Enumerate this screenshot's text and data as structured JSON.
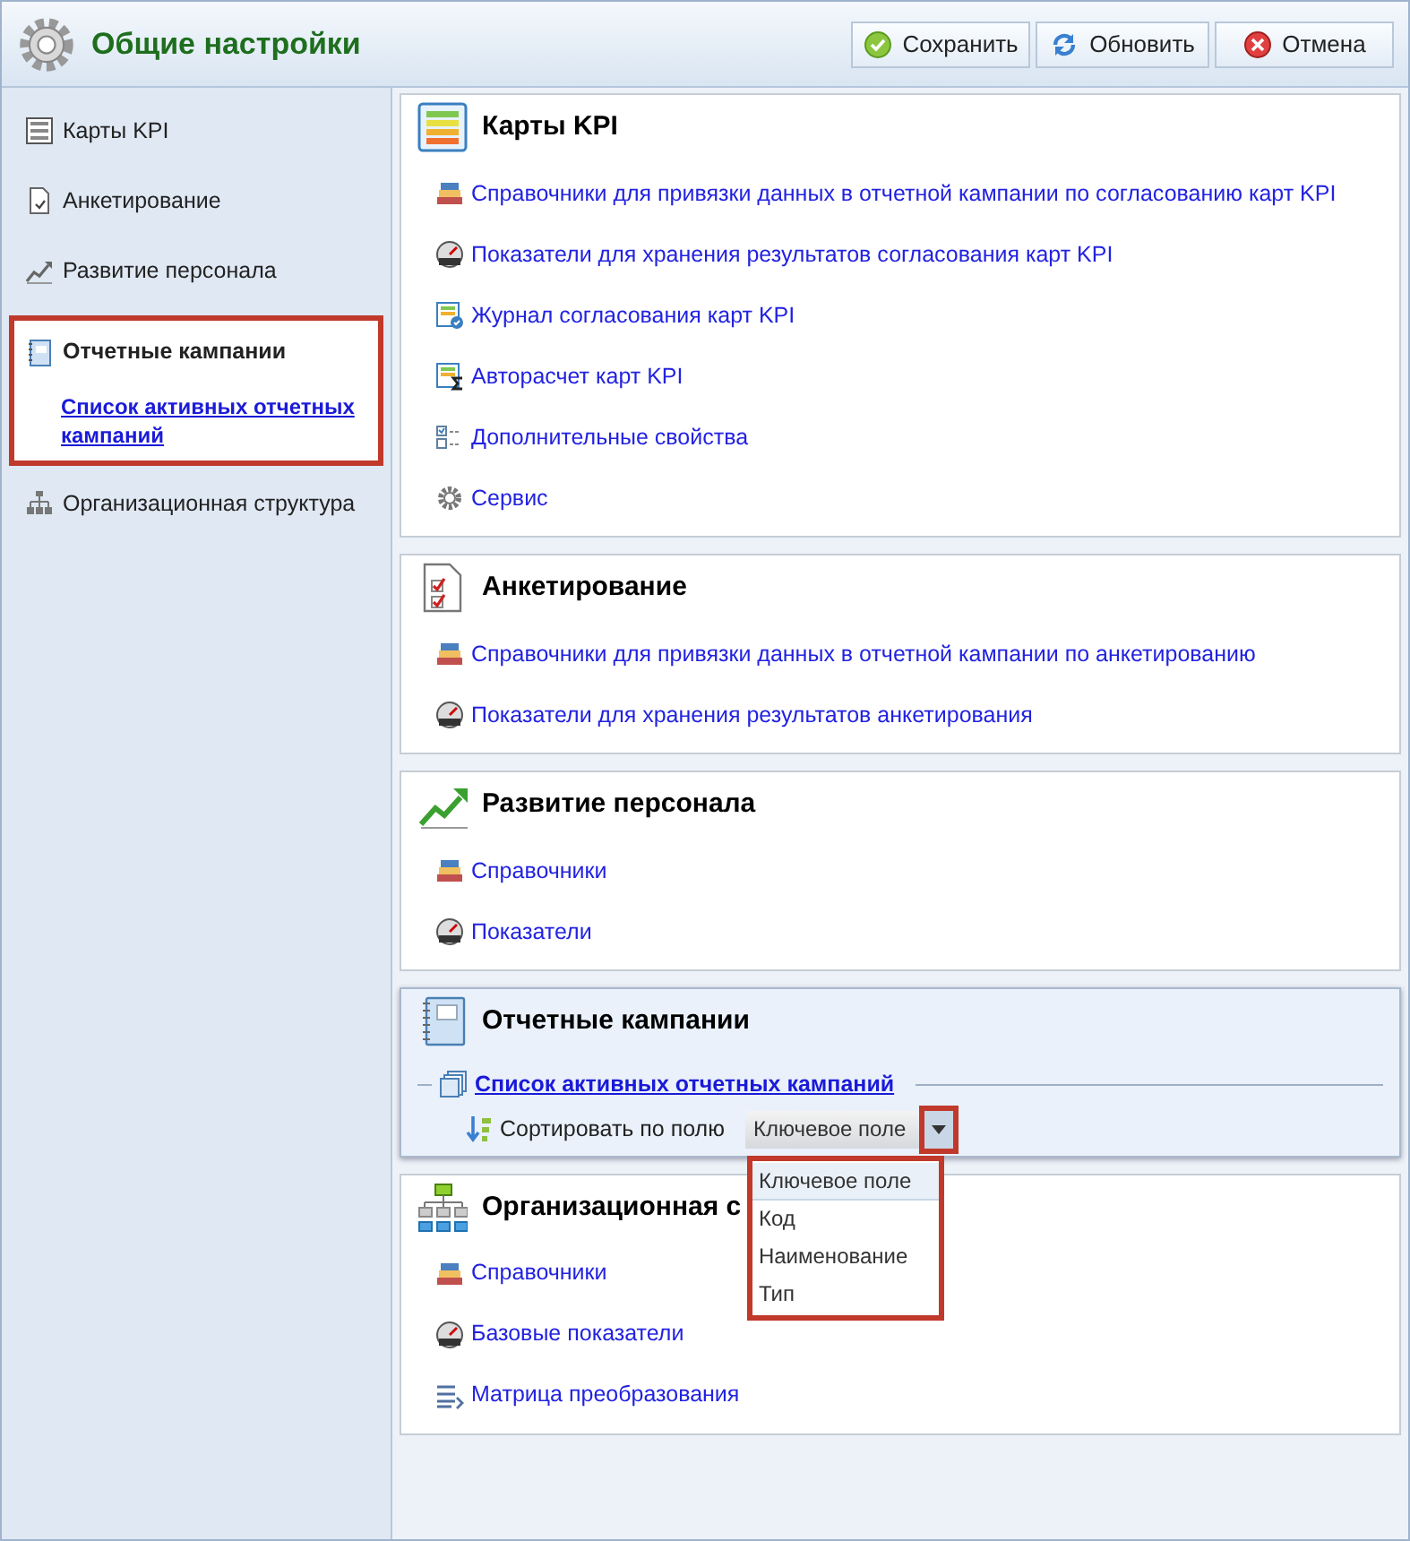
{
  "header": {
    "title": "Общие настройки",
    "buttons": [
      {
        "label": "Сохранить",
        "kind": "save"
      },
      {
        "label": "Обновить",
        "kind": "refresh"
      },
      {
        "label": "Отмена",
        "kind": "cancel"
      }
    ]
  },
  "sidebar": {
    "items": [
      {
        "label": "Карты KPI",
        "kind": "kpi",
        "selected": false
      },
      {
        "label": "Анкетирование",
        "kind": "survey",
        "selected": false
      },
      {
        "label": "Развитие персонала",
        "kind": "growth",
        "selected": false
      },
      {
        "label": "Отчетные кампании",
        "kind": "notebook",
        "selected": true,
        "children": [
          {
            "label": "Список активных отчетных кампаний"
          }
        ]
      },
      {
        "label": "Организационная структура",
        "kind": "org",
        "selected": false
      }
    ]
  },
  "sections": [
    {
      "title": "Карты KPI",
      "kind": "kpi",
      "selected": false,
      "links": [
        {
          "label": "Справочники для привязки данных в отчетной кампании по согласованию карт KPI",
          "kind": "books"
        },
        {
          "label": "Показатели для хранения результатов согласования карт KPI",
          "kind": "gauge"
        },
        {
          "label": "Журнал согласования карт KPI",
          "kind": "journal"
        },
        {
          "label": "Авторасчет карт KPI",
          "kind": "autocalc"
        },
        {
          "label": "Дополнительные свойства",
          "kind": "props"
        },
        {
          "label": "Сервис",
          "kind": "gear"
        }
      ]
    },
    {
      "title": "Анкетирование",
      "kind": "survey",
      "selected": false,
      "links": [
        {
          "label": "Справочники для привязки данных в отчетной кампании по анкетированию",
          "kind": "books"
        },
        {
          "label": "Показатели для хранения результатов анкетирования",
          "kind": "gauge"
        }
      ]
    },
    {
      "title": "Развитие персонала",
      "kind": "growth",
      "selected": false,
      "links": [
        {
          "label": "Справочники",
          "kind": "books"
        },
        {
          "label": "Показатели",
          "kind": "gauge"
        }
      ]
    },
    {
      "title": "Отчетные кампании",
      "kind": "notebook",
      "selected": true,
      "group": {
        "label": "Список активных отчетных кампаний",
        "sort": {
          "label": "Сортировать по полю",
          "value": "Ключевое поле",
          "highlighted": true,
          "expanded": true,
          "options": [
            {
              "label": "Ключевое поле",
              "selected": true
            },
            {
              "label": "Код",
              "selected": false
            },
            {
              "label": "Наименование",
              "selected": false
            },
            {
              "label": "Тип",
              "selected": false
            }
          ]
        }
      }
    },
    {
      "title": "Организационная с",
      "kind": "org",
      "selected": false,
      "links": [
        {
          "label": "Справочники",
          "kind": "books"
        },
        {
          "label": "Базовые показатели",
          "kind": "gauge"
        },
        {
          "label": "Матрица преобразования",
          "kind": "matrix"
        }
      ]
    }
  ]
}
